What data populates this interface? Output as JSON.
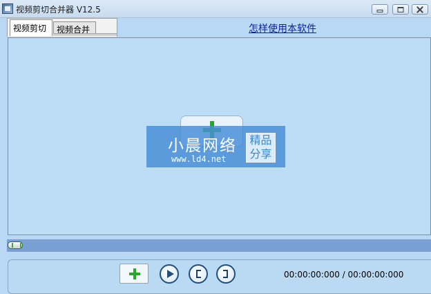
{
  "window": {
    "title": "视频剪切合并器 V12.5",
    "icons": [
      "app-icon",
      "minimize-icon",
      "maximize-icon",
      "close-icon"
    ]
  },
  "tabs": [
    {
      "label": "视频剪切",
      "active": true
    },
    {
      "label": "视频合并",
      "active": false
    }
  ],
  "help_link": "怎样使用本软件",
  "video_area": {
    "add_button_icon": "plus-icon"
  },
  "watermark": {
    "title": "小晨网络",
    "url": "www.ld4.net",
    "badge_line1": "精品",
    "badge_line2": "分享"
  },
  "timeline": {
    "position": 0
  },
  "controls": {
    "add_icon": "plus-icon",
    "play_icon": "play-icon",
    "mark_in_icon": "mark-in-bracket-icon",
    "mark_out_icon": "mark-out-bracket-icon",
    "time_readout": "00:00:00:000 / 00:00:00:000"
  },
  "colors": {
    "background": "#b9d8f3",
    "timeline": "#7a9fd4",
    "accent_green": "#2ca52c",
    "link": "#0b1fa8"
  }
}
